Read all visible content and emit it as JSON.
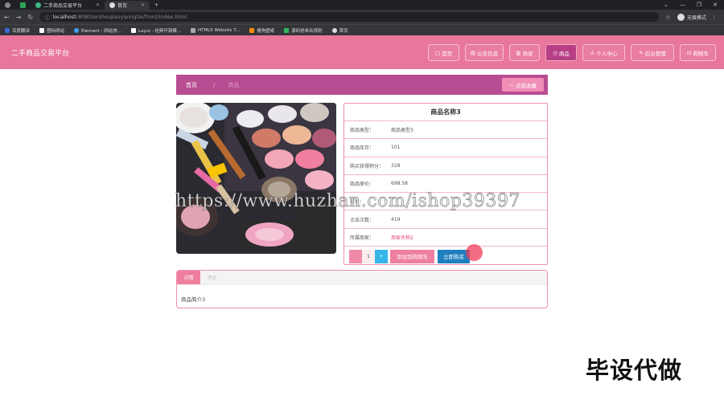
{
  "browser": {
    "tabs": [
      {
        "label": "二手商品交易平台",
        "color": "#41b883"
      },
      {
        "label": "首页",
        "color": "#dddddd"
      }
    ],
    "new_tab": "+",
    "url_host": "localhost",
    "url_path": ":8080/ershoujiaoyipingtai/front/index.html",
    "incognito_label": "无痕模式",
    "bookmarks": [
      {
        "label": "百度翻译",
        "color": "#3b6bd6"
      },
      {
        "label": "图标网站",
        "color": "#ffffff"
      },
      {
        "label": "Element - 网站快...",
        "color": "#3fa0ff"
      },
      {
        "label": "Layui - 经典开源模...",
        "color": "#ffffff"
      },
      {
        "label": "HTML5 Website T...",
        "color": "#aaaaaa"
      },
      {
        "label": "搜狗壁纸",
        "color": "#ff8a00"
      },
      {
        "label": "源码抢单名规则",
        "color": "#2fb45a"
      },
      {
        "label": "首页",
        "color": "#dddddd"
      }
    ]
  },
  "site": {
    "title": "二手商品交易平台",
    "nav": [
      {
        "icon": "□",
        "label": "首页",
        "width": 39,
        "active": false
      },
      {
        "icon": "▤",
        "label": "公告信息",
        "width": 48,
        "active": false
      },
      {
        "icon": "▥",
        "label": "商家",
        "width": 38,
        "active": false
      },
      {
        "icon": "◷",
        "label": "商品",
        "width": 39,
        "active": true
      },
      {
        "icon": "♙",
        "label": "个人中心",
        "width": 53,
        "active": false
      },
      {
        "icon": "✎",
        "label": "后台管理",
        "width": 54,
        "active": false
      },
      {
        "icon": "⊡",
        "label": "购物车",
        "width": 45,
        "active": false
      }
    ]
  },
  "breadcrumb": {
    "home": "首页",
    "separator": "/",
    "current": "商品"
  },
  "favorite_label": "点我收藏",
  "product": {
    "name": "商品名称3",
    "fields": [
      {
        "label": "商品类型：",
        "value": "商品类型3",
        "link": false
      },
      {
        "label": "商品库存：",
        "value": "101",
        "link": false
      },
      {
        "label": "购买获得积分：",
        "value": "328",
        "link": false
      },
      {
        "label": "商品原价：",
        "value": "698.58",
        "link": false
      },
      {
        "label": "现价：",
        "value": "",
        "link": false
      },
      {
        "label": "点击次数：",
        "value": "419",
        "link": false
      },
      {
        "label": "所属商家：",
        "value": "商家名称2",
        "link": true
      }
    ],
    "quantity": "1",
    "add_to_cart": "添加到购物车",
    "buy_now": "立即购买"
  },
  "detail": {
    "tabs": [
      "详情",
      "评论"
    ],
    "body": "商品简介3"
  },
  "overlay": {
    "watermark": "https://www.huzhan.com/ishop39397",
    "stamp": "毕设代做"
  }
}
